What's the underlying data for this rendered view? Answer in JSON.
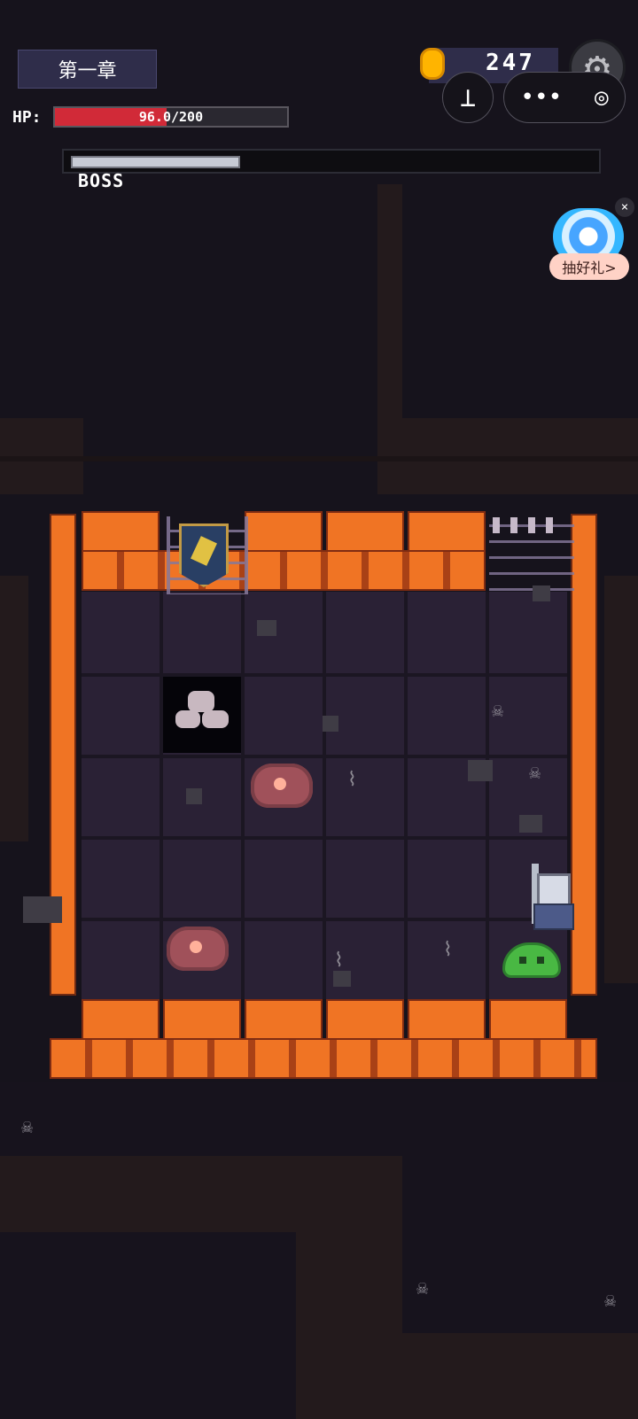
{
  "chapter": {
    "label": "第一章"
  },
  "player": {
    "hp_label": "HP:",
    "hp_text": "96.0/200",
    "hp_fraction": 0.48
  },
  "currency": {
    "coins": "247",
    "icon": "coin-icon"
  },
  "controls": {
    "settings_icon": "gear-icon",
    "mini_button_icon": "joystick-icon",
    "capsule_left": "•••",
    "capsule_right": "◎"
  },
  "boss": {
    "label": "BOSS",
    "progress_fraction": 0.31
  },
  "promo": {
    "label": "抽好礼>",
    "close": "×"
  },
  "icons": {
    "slime": "slime-icon",
    "knight": "knight-icon",
    "bat": "bat-icon",
    "rubble": "rubble-icon",
    "banner": "banner-icon",
    "spikes": "spikes-icon"
  },
  "colors": {
    "hp": "#d12a38",
    "gold": "#ffb400",
    "wall": "#f07424"
  }
}
